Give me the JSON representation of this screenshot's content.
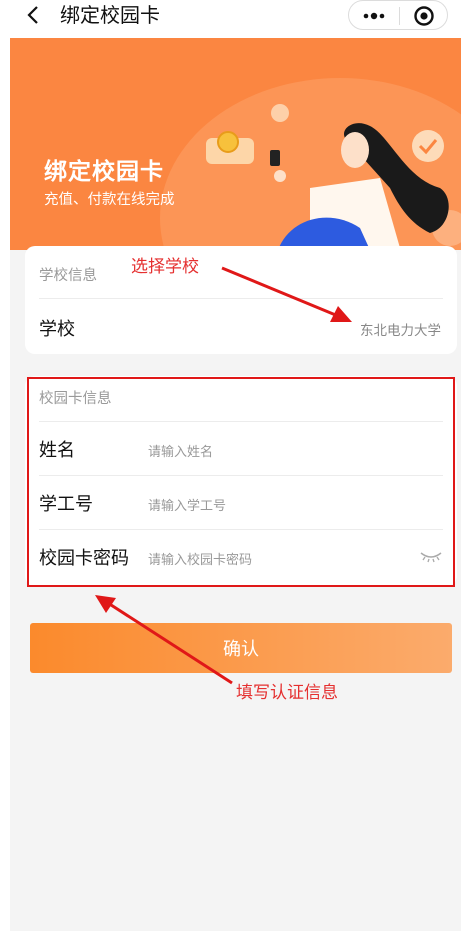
{
  "nav": {
    "title": "绑定校园卡"
  },
  "banner": {
    "title": "绑定校园卡",
    "subtitle": "充值、付款在线完成"
  },
  "school_section": {
    "title": "学校信息",
    "label": "学校",
    "value": "东北电力大学"
  },
  "card_section": {
    "title": "校园卡信息",
    "fields": [
      {
        "label": "姓名",
        "placeholder": "请输入姓名"
      },
      {
        "label": "学工号",
        "placeholder": "请输入学工号"
      },
      {
        "label": "校园卡密码",
        "placeholder": "请输入校园卡密码"
      }
    ]
  },
  "confirm_label": "确认",
  "annotations": {
    "choose_school": "选择学校",
    "fill_auth": "填写认证信息"
  },
  "colors": {
    "brand_orange": "#fb8641",
    "annotation_red": "#e01818",
    "button_start": "#fb8a2c",
    "button_end": "#fbab6c"
  }
}
